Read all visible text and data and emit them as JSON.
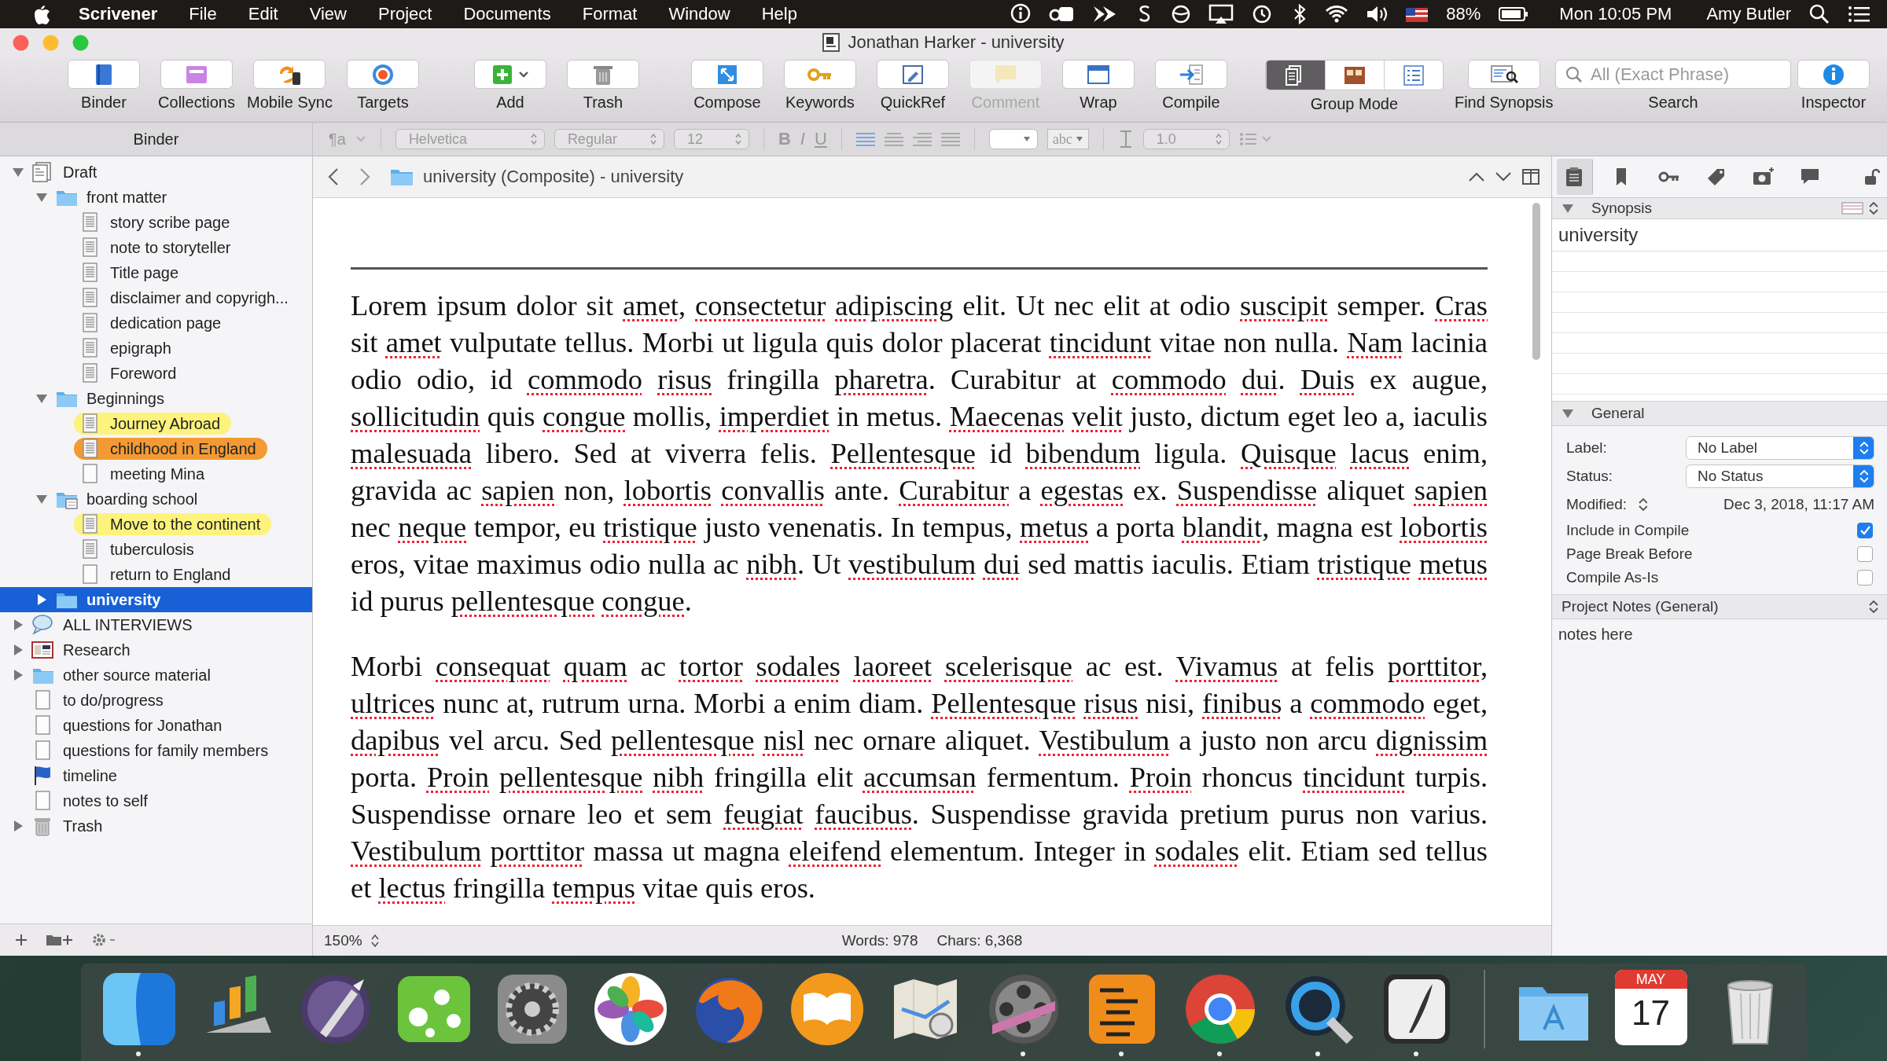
{
  "menu_bar": {
    "app": "Scrivener",
    "menus": [
      "File",
      "Edit",
      "View",
      "Project",
      "Documents",
      "Format",
      "Window",
      "Help"
    ],
    "battery": "88%",
    "clock": "Mon 10:05 PM",
    "user": "Amy Butler"
  },
  "window": {
    "title": "Jonathan Harker - university"
  },
  "toolbar": {
    "groups": [
      [
        {
          "kind": "binder",
          "label": "Binder",
          "disabled": false
        },
        {
          "kind": "collections",
          "label": "Collections",
          "disabled": false
        },
        {
          "kind": "sync",
          "label": "Mobile Sync",
          "disabled": false
        },
        {
          "kind": "targets",
          "label": "Targets",
          "disabled": false
        }
      ],
      [
        {
          "kind": "add",
          "label": "Add",
          "disabled": false
        },
        {
          "kind": "trash",
          "label": "Trash",
          "disabled": false
        }
      ],
      [
        {
          "kind": "compose",
          "label": "Compose",
          "disabled": false
        },
        {
          "kind": "keywords",
          "label": "Keywords",
          "disabled": false
        },
        {
          "kind": "quickref",
          "label": "QuickRef",
          "disabled": false
        },
        {
          "kind": "comment",
          "label": "Comment",
          "disabled": true
        },
        {
          "kind": "wrap",
          "label": "Wrap",
          "disabled": false
        },
        {
          "kind": "compile",
          "label": "Compile",
          "disabled": false
        }
      ],
      [
        {
          "kind": "group-mode",
          "label": "Group Mode",
          "disabled": false,
          "segments": [
            {
              "kind": "document",
              "selected": true
            },
            {
              "kind": "corkboard",
              "selected": false
            },
            {
              "kind": "outline",
              "selected": false
            }
          ]
        }
      ],
      [
        {
          "kind": "find-synopsis",
          "label": "Find Synopsis",
          "disabled": false
        }
      ],
      [
        {
          "kind": "search",
          "label": "Search",
          "disabled": false,
          "placeholder": "All (Exact Phrase)"
        }
      ],
      [
        {
          "kind": "inspector",
          "label": "Inspector",
          "disabled": false
        }
      ]
    ]
  },
  "format_bar": {
    "paragraph_style": "¶a",
    "font": "Helvetica",
    "weight": "Regular",
    "size": "12",
    "bold": "B",
    "italic": "I",
    "underline": "U",
    "highlight": "abc",
    "line_spacing": "1.0"
  },
  "binder": {
    "title": "Binder",
    "tree": [
      {
        "kind": "draft",
        "title": "Draft",
        "expanded": true,
        "selected": false,
        "children": [
          {
            "kind": "folder",
            "title": "front matter",
            "expanded": true,
            "selected": false,
            "children": [
              {
                "kind": "text-doc",
                "title": "story scribe page",
                "selected": false
              },
              {
                "kind": "text-doc",
                "title": "note to storyteller",
                "selected": false
              },
              {
                "kind": "text-doc",
                "title": "Title page",
                "selected": false
              },
              {
                "kind": "text-doc",
                "title": "disclaimer and copyrigh...",
                "selected": false
              },
              {
                "kind": "text-doc",
                "title": "dedication page",
                "selected": false
              },
              {
                "kind": "text-doc",
                "title": "epigraph",
                "selected": false
              },
              {
                "kind": "text-doc",
                "title": "Foreword",
                "selected": false
              }
            ]
          },
          {
            "kind": "folder",
            "title": "Beginnings",
            "expanded": true,
            "selected": false,
            "children": [
              {
                "kind": "text-doc",
                "title": "Journey Abroad",
                "selected": false,
                "color": "#fdf37c"
              },
              {
                "kind": "text-doc",
                "title": "childhood in England",
                "selected": false,
                "color": "#f39a34"
              },
              {
                "kind": "blank-doc",
                "title": "meeting Mina",
                "selected": false
              }
            ]
          },
          {
            "kind": "folder-doc",
            "title": "boarding school",
            "expanded": true,
            "selected": false,
            "children": [
              {
                "kind": "text-doc",
                "title": "Move to the continent",
                "selected": false,
                "color": "#fdf37c"
              },
              {
                "kind": "text-doc",
                "title": "tuberculosis",
                "selected": false
              },
              {
                "kind": "blank-doc",
                "title": "return to England",
                "selected": false
              }
            ]
          },
          {
            "kind": "folder",
            "title": "university",
            "expanded": false,
            "selected": true
          }
        ]
      },
      {
        "kind": "interviews",
        "title": "ALL INTERVIEWS",
        "expanded": false,
        "selected": false
      },
      {
        "kind": "research",
        "title": "Research",
        "expanded": false,
        "selected": false
      },
      {
        "kind": "folder",
        "title": "other source material",
        "expanded": false,
        "selected": false
      },
      {
        "kind": "blank-doc",
        "title": "to do/progress",
        "selected": false
      },
      {
        "kind": "blank-doc",
        "title": "questions for Jonathan",
        "selected": false
      },
      {
        "kind": "blank-doc",
        "title": "questions for family members",
        "selected": false
      },
      {
        "kind": "flag",
        "title": "timeline",
        "selected": false
      },
      {
        "kind": "blank-doc",
        "title": "notes to self",
        "selected": false
      },
      {
        "kind": "trash",
        "title": "Trash",
        "expanded": false,
        "selected": false
      }
    ]
  },
  "editor": {
    "path": "university (Composite) - university",
    "paragraphs": [
      {
        "runs": [
          {
            "text": "Lorem ipsum dolor sit ",
            "misspelled": false
          },
          {
            "text": "amet",
            "misspelled": true
          },
          {
            "text": ", ",
            "misspelled": false
          },
          {
            "text": "consectetur ",
            "misspelled": true
          },
          {
            "text": "adipiscing",
            "misspelled": true
          },
          {
            "text": " elit. Ut nec elit at odio ",
            "misspelled": false
          },
          {
            "text": "suscipit",
            "misspelled": true
          },
          {
            "text": " semper. ",
            "misspelled": false
          },
          {
            "text": "Cras",
            "misspelled": true
          },
          {
            "text": " sit ",
            "misspelled": false
          },
          {
            "text": "amet",
            "misspelled": true
          },
          {
            "text": " vulputate tellus. Morbi ut ligula quis dolor placerat ",
            "misspelled": false
          },
          {
            "text": "tincidunt",
            "misspelled": true
          },
          {
            "text": " vitae non nulla. ",
            "misspelled": false
          },
          {
            "text": "Nam",
            "misspelled": true
          },
          {
            "text": " lacinia odio odio, id ",
            "misspelled": false
          },
          {
            "text": "commodo ",
            "misspelled": true
          },
          {
            "text": "risus",
            "misspelled": true
          },
          {
            "text": " fringilla ",
            "misspelled": false
          },
          {
            "text": "pharetra",
            "misspelled": true
          },
          {
            "text": ". Curabitur at ",
            "misspelled": false
          },
          {
            "text": "commodo ",
            "misspelled": true
          },
          {
            "text": "dui",
            "misspelled": true
          },
          {
            "text": ". ",
            "misspelled": false
          },
          {
            "text": "Duis",
            "misspelled": true
          },
          {
            "text": " ex augue, ",
            "misspelled": false
          },
          {
            "text": "sollicitudin",
            "misspelled": true
          },
          {
            "text": " quis ",
            "misspelled": false
          },
          {
            "text": "congue",
            "misspelled": true
          },
          {
            "text": " mollis, ",
            "misspelled": false
          },
          {
            "text": "imperdiet",
            "misspelled": true
          },
          {
            "text": " in metus. ",
            "misspelled": false
          },
          {
            "text": "Maecenas ",
            "misspelled": true
          },
          {
            "text": "velit",
            "misspelled": true
          },
          {
            "text": " justo, dictum eget leo a, iaculis ",
            "misspelled": false
          },
          {
            "text": "malesuada",
            "misspelled": true
          },
          {
            "text": " libero. Sed at viverra felis. ",
            "misspelled": false
          },
          {
            "text": "Pellentesque",
            "misspelled": true
          },
          {
            "text": " id ",
            "misspelled": false
          },
          {
            "text": "bibendum",
            "misspelled": true
          },
          {
            "text": " ligula. ",
            "misspelled": false
          },
          {
            "text": "Quisque ",
            "misspelled": true
          },
          {
            "text": "lacus",
            "misspelled": true
          },
          {
            "text": " enim, gravida ac ",
            "misspelled": false
          },
          {
            "text": "sapien",
            "misspelled": true
          },
          {
            "text": " non, ",
            "misspelled": false
          },
          {
            "text": "lobortis ",
            "misspelled": true
          },
          {
            "text": "convallis",
            "misspelled": true
          },
          {
            "text": " ante. ",
            "misspelled": false
          },
          {
            "text": "Curabitur",
            "misspelled": true
          },
          {
            "text": " a ",
            "misspelled": false
          },
          {
            "text": "egestas",
            "misspelled": true
          },
          {
            "text": " ex. ",
            "misspelled": false
          },
          {
            "text": "Suspendisse",
            "misspelled": true
          },
          {
            "text": " aliquet ",
            "misspelled": false
          },
          {
            "text": "sapien",
            "misspelled": true
          },
          {
            "text": " nec ",
            "misspelled": false
          },
          {
            "text": "neque",
            "misspelled": true
          },
          {
            "text": " tempor, eu ",
            "misspelled": false
          },
          {
            "text": "tristique",
            "misspelled": true
          },
          {
            "text": " justo venenatis. In tempus, ",
            "misspelled": false
          },
          {
            "text": "metus",
            "misspelled": true
          },
          {
            "text": " a porta ",
            "misspelled": false
          },
          {
            "text": "blandit",
            "misspelled": true
          },
          {
            "text": ", magna est ",
            "misspelled": false
          },
          {
            "text": "lobortis",
            "misspelled": true
          },
          {
            "text": " eros, vitae maximus odio nulla ac ",
            "misspelled": false
          },
          {
            "text": "nibh",
            "misspelled": true
          },
          {
            "text": ". Ut ",
            "misspelled": false
          },
          {
            "text": "vestibulum ",
            "misspelled": true
          },
          {
            "text": "dui",
            "misspelled": true
          },
          {
            "text": " sed mattis iaculis. Etiam ",
            "misspelled": false
          },
          {
            "text": "tristique ",
            "misspelled": true
          },
          {
            "text": "metus",
            "misspelled": true
          },
          {
            "text": " id purus ",
            "misspelled": false
          },
          {
            "text": "pellentesque ",
            "misspelled": true
          },
          {
            "text": "congue",
            "misspelled": true
          },
          {
            "text": ".",
            "misspelled": false
          }
        ]
      },
      {
        "runs": [
          {
            "text": "Morbi ",
            "misspelled": false
          },
          {
            "text": "consequat ",
            "misspelled": true
          },
          {
            "text": "quam",
            "misspelled": true
          },
          {
            "text": " ac ",
            "misspelled": false
          },
          {
            "text": "tortor ",
            "misspelled": true
          },
          {
            "text": "sodales ",
            "misspelled": true
          },
          {
            "text": "laoreet ",
            "misspelled": true
          },
          {
            "text": "scelerisque",
            "misspelled": true
          },
          {
            "text": " ac est. ",
            "misspelled": false
          },
          {
            "text": "Vivamus",
            "misspelled": true
          },
          {
            "text": " at felis ",
            "misspelled": false
          },
          {
            "text": "porttitor",
            "misspelled": true
          },
          {
            "text": ", ",
            "misspelled": false
          },
          {
            "text": "ultrices",
            "misspelled": true
          },
          {
            "text": " nunc at, rutrum urna. Morbi a enim diam. ",
            "misspelled": false
          },
          {
            "text": "Pellentesque ",
            "misspelled": true
          },
          {
            "text": "risus",
            "misspelled": true
          },
          {
            "text": " nisi, ",
            "misspelled": false
          },
          {
            "text": "finibus",
            "misspelled": true
          },
          {
            "text": " a ",
            "misspelled": false
          },
          {
            "text": "commodo",
            "misspelled": true
          },
          {
            "text": " eget, ",
            "misspelled": false
          },
          {
            "text": "dapibus",
            "misspelled": true
          },
          {
            "text": " vel arcu. Sed ",
            "misspelled": false
          },
          {
            "text": "pellentesque ",
            "misspelled": true
          },
          {
            "text": "nisl",
            "misspelled": true
          },
          {
            "text": " nec ornare aliquet. ",
            "misspelled": false
          },
          {
            "text": "Vestibulum",
            "misspelled": true
          },
          {
            "text": " a justo non arcu ",
            "misspelled": false
          },
          {
            "text": "dignissim",
            "misspelled": true
          },
          {
            "text": " porta. ",
            "misspelled": false
          },
          {
            "text": "Proin ",
            "misspelled": true
          },
          {
            "text": "pellentesque ",
            "misspelled": true
          },
          {
            "text": "nibh",
            "misspelled": true
          },
          {
            "text": " fringilla elit ",
            "misspelled": false
          },
          {
            "text": "accumsan",
            "misspelled": true
          },
          {
            "text": " fermentum. ",
            "misspelled": false
          },
          {
            "text": "Proin",
            "misspelled": true
          },
          {
            "text": " rhoncus ",
            "misspelled": false
          },
          {
            "text": "tincidunt",
            "misspelled": true
          },
          {
            "text": " turpis. Suspendisse ornare leo et sem ",
            "misspelled": false
          },
          {
            "text": "feugiat ",
            "misspelled": true
          },
          {
            "text": "faucibus",
            "misspelled": true
          },
          {
            "text": ". Suspendisse gravida pretium purus non varius. ",
            "misspelled": false
          },
          {
            "text": "Vestibulum ",
            "misspelled": true
          },
          {
            "text": "porttitor",
            "misspelled": true
          },
          {
            "text": " massa ut magna ",
            "misspelled": false
          },
          {
            "text": "eleifend",
            "misspelled": true
          },
          {
            "text": " elementum. Integer in ",
            "misspelled": false
          },
          {
            "text": "sodales",
            "misspelled": true
          },
          {
            "text": " elit. Etiam sed tellus et ",
            "misspelled": false
          },
          {
            "text": "lectus",
            "misspelled": true
          },
          {
            "text": " fringilla ",
            "misspelled": false
          },
          {
            "text": "tempus",
            "misspelled": true
          },
          {
            "text": " vitae quis eros.",
            "misspelled": false
          }
        ]
      }
    ],
    "zoom": "150%",
    "words": "Words: 978",
    "chars": "Chars: 6,368"
  },
  "inspector": {
    "tabs": [
      {
        "kind": "notes",
        "selected": true
      },
      {
        "kind": "bookmark",
        "selected": false
      },
      {
        "kind": "key",
        "selected": false
      },
      {
        "kind": "tag",
        "selected": false
      },
      {
        "kind": "snapshot",
        "selected": false
      },
      {
        "kind": "comment",
        "selected": false
      }
    ],
    "synopsis": {
      "title": "Synopsis",
      "text": "university"
    },
    "general": {
      "title": "General",
      "fields": [
        {
          "kind": "popup",
          "label": "Label:",
          "value": "No Label"
        },
        {
          "kind": "popup",
          "label": "Status:",
          "value": "No Status"
        },
        {
          "kind": "date",
          "label": "Modified:",
          "value": "Dec 3, 2018, 11:17 AM"
        }
      ],
      "options": [
        {
          "label": "Include in Compile",
          "checked": true
        },
        {
          "label": "Page Break Before",
          "checked": false
        },
        {
          "label": "Compile As-Is",
          "checked": false
        }
      ]
    },
    "notes": {
      "title": "Project Notes (General)",
      "text": "notes here"
    }
  },
  "dock": {
    "apps": [
      {
        "kind": "finder",
        "running": true
      },
      {
        "kind": "chart",
        "running": false
      },
      {
        "kind": "pen",
        "running": false
      },
      {
        "kind": "mindmap",
        "running": false
      },
      {
        "kind": "gear",
        "running": false
      },
      {
        "kind": "flower",
        "running": false
      },
      {
        "kind": "globe",
        "running": false
      },
      {
        "kind": "book",
        "running": false
      },
      {
        "kind": "map",
        "running": false
      },
      {
        "kind": "film",
        "running": true
      },
      {
        "kind": "outline",
        "running": true
      },
      {
        "kind": "ring",
        "running": true
      },
      {
        "kind": "magnifier",
        "running": true
      },
      {
        "kind": "quill",
        "running": true
      }
    ],
    "others": [
      {
        "kind": "folder",
        "running": false
      },
      {
        "kind": "calendar",
        "running": false,
        "month": "MAY",
        "day": "17"
      },
      {
        "kind": "trash",
        "running": false
      }
    ]
  }
}
